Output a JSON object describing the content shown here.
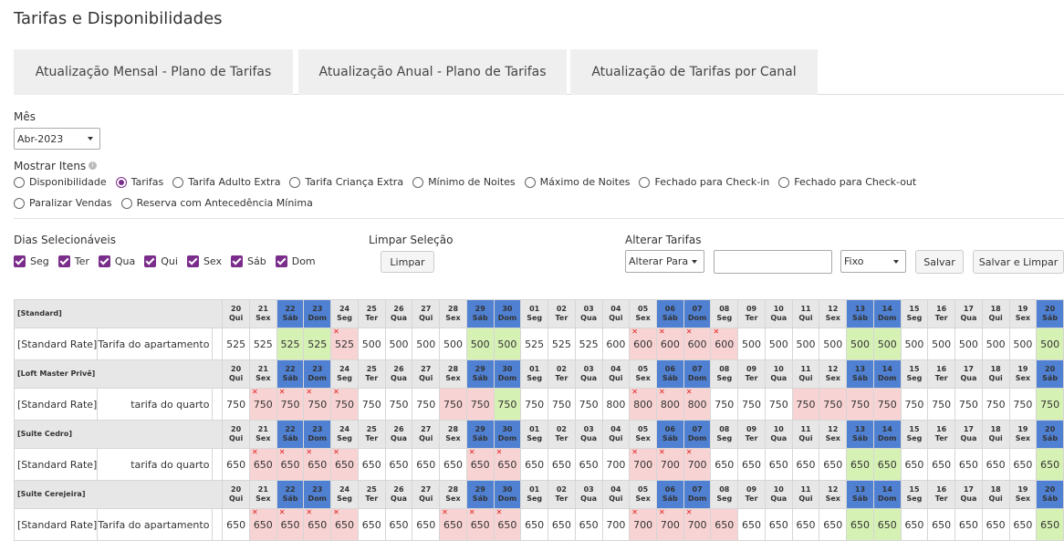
{
  "page_title": "Tarifas e Disponibilidades",
  "tabs": [
    {
      "label": "Atualização Mensal - Plano de Tarifas"
    },
    {
      "label": "Atualização Anual - Plano de Tarifas"
    },
    {
      "label": "Atualização de Tarifas por Canal"
    }
  ],
  "month": {
    "label": "Mês",
    "value": "Abr-2023"
  },
  "show_items": {
    "label": "Mostrar Itens",
    "options": [
      {
        "label": "Disponibilidade",
        "selected": false
      },
      {
        "label": "Tarifas",
        "selected": true
      },
      {
        "label": "Tarifa Adulto Extra",
        "selected": false
      },
      {
        "label": "Tarifa Criança Extra",
        "selected": false
      },
      {
        "label": "Mínimo de Noites",
        "selected": false
      },
      {
        "label": "Máximo de Noites",
        "selected": false
      },
      {
        "label": "Fechado para Check-in",
        "selected": false
      },
      {
        "label": "Fechado para Check-out",
        "selected": false
      },
      {
        "label": "Paralizar Vendas",
        "selected": false
      },
      {
        "label": "Reserva com Antecedência Mínima",
        "selected": false
      }
    ]
  },
  "selectable_days": {
    "label": "Dias Selecionáveis",
    "days": [
      {
        "label": "Seg",
        "checked": true
      },
      {
        "label": "Ter",
        "checked": true
      },
      {
        "label": "Qua",
        "checked": true
      },
      {
        "label": "Qui",
        "checked": true
      },
      {
        "label": "Sex",
        "checked": true
      },
      {
        "label": "Sáb",
        "checked": true
      },
      {
        "label": "Dom",
        "checked": true
      }
    ]
  },
  "clear_selection": {
    "label": "Limpar Seleção",
    "button": "Limpar"
  },
  "change_rates": {
    "label": "Alterar Tarifas",
    "mode": "Alterar Para",
    "value": "",
    "type": "Fixo",
    "save": "Salvar",
    "save_clear": "Salvar e Limpar"
  },
  "colors": {
    "weekend_header": "#4f80d2",
    "green_cell": "#d6f1b4",
    "red_cell": "#f8d3d3",
    "accent": "#7b2d8b"
  },
  "dates": [
    {
      "d": "20",
      "w": "Qui",
      "we": false
    },
    {
      "d": "21",
      "w": "Sex",
      "we": false
    },
    {
      "d": "22",
      "w": "Sáb",
      "we": true
    },
    {
      "d": "23",
      "w": "Dom",
      "we": true
    },
    {
      "d": "24",
      "w": "Seg",
      "we": false
    },
    {
      "d": "25",
      "w": "Ter",
      "we": false
    },
    {
      "d": "26",
      "w": "Qua",
      "we": false
    },
    {
      "d": "27",
      "w": "Qui",
      "we": false
    },
    {
      "d": "28",
      "w": "Sex",
      "we": false
    },
    {
      "d": "29",
      "w": "Sáb",
      "we": true
    },
    {
      "d": "30",
      "w": "Dom",
      "we": true
    },
    {
      "d": "01",
      "w": "Seg",
      "we": false
    },
    {
      "d": "02",
      "w": "Ter",
      "we": false
    },
    {
      "d": "03",
      "w": "Qua",
      "we": false
    },
    {
      "d": "04",
      "w": "Qui",
      "we": false
    },
    {
      "d": "05",
      "w": "Sex",
      "we": false
    },
    {
      "d": "06",
      "w": "Sáb",
      "we": true
    },
    {
      "d": "07",
      "w": "Dom",
      "we": true
    },
    {
      "d": "08",
      "w": "Seg",
      "we": false
    },
    {
      "d": "09",
      "w": "Ter",
      "we": false
    },
    {
      "d": "10",
      "w": "Qua",
      "we": false
    },
    {
      "d": "11",
      "w": "Qui",
      "we": false
    },
    {
      "d": "12",
      "w": "Sex",
      "we": false
    },
    {
      "d": "13",
      "w": "Sáb",
      "we": true
    },
    {
      "d": "14",
      "w": "Dom",
      "we": true
    },
    {
      "d": "15",
      "w": "Seg",
      "we": false
    },
    {
      "d": "16",
      "w": "Ter",
      "we": false
    },
    {
      "d": "17",
      "w": "Qua",
      "we": false
    },
    {
      "d": "18",
      "w": "Qui",
      "we": false
    },
    {
      "d": "19",
      "w": "Sex",
      "we": false
    },
    {
      "d": "20",
      "w": "Sáb",
      "we": true
    }
  ],
  "rooms": [
    {
      "name": "[Standard]",
      "rate_name": "[Standard Rate]",
      "rate_desc": "Tarifa do apartamento",
      "values": [
        525,
        525,
        525,
        525,
        525,
        500,
        500,
        500,
        500,
        500,
        500,
        525,
        525,
        525,
        600,
        600,
        600,
        600,
        600,
        500,
        500,
        500,
        500,
        500,
        500,
        500,
        500,
        500,
        500,
        500,
        500
      ],
      "state": [
        "w",
        "w",
        "g",
        "g",
        "r",
        "w",
        "w",
        "w",
        "w",
        "g",
        "g",
        "w",
        "w",
        "w",
        "w",
        "r",
        "r",
        "r",
        "r",
        "w",
        "w",
        "w",
        "w",
        "g",
        "g",
        "w",
        "w",
        "w",
        "w",
        "w",
        "g"
      ],
      "closed": [
        0,
        0,
        0,
        0,
        1,
        0,
        0,
        0,
        0,
        0,
        0,
        0,
        0,
        0,
        0,
        1,
        1,
        1,
        1,
        0,
        0,
        0,
        0,
        0,
        0,
        0,
        0,
        0,
        0,
        0,
        0
      ]
    },
    {
      "name": "[Loft Master Privê]",
      "rate_name": "[Standard Rate]",
      "rate_desc": "tarifa do quarto",
      "values": [
        750,
        750,
        750,
        750,
        750,
        750,
        750,
        750,
        750,
        750,
        750,
        750,
        750,
        750,
        800,
        800,
        800,
        800,
        750,
        750,
        750,
        750,
        750,
        750,
        750,
        750,
        750,
        750,
        750,
        750,
        750
      ],
      "state": [
        "w",
        "r",
        "r",
        "r",
        "r",
        "w",
        "w",
        "w",
        "r",
        "r",
        "g",
        "w",
        "w",
        "w",
        "w",
        "r",
        "r",
        "r",
        "w",
        "w",
        "w",
        "r",
        "r",
        "r",
        "r",
        "w",
        "w",
        "w",
        "w",
        "w",
        "g"
      ],
      "closed": [
        0,
        1,
        1,
        1,
        1,
        0,
        0,
        0,
        0,
        0,
        0,
        0,
        0,
        0,
        0,
        1,
        1,
        1,
        0,
        0,
        0,
        0,
        0,
        0,
        0,
        0,
        0,
        0,
        0,
        0,
        0
      ]
    },
    {
      "name": "[Suite Cedro]",
      "rate_name": "[Standard Rate]",
      "rate_desc": "tarifa do quarto",
      "values": [
        650,
        650,
        650,
        650,
        650,
        650,
        650,
        650,
        650,
        650,
        650,
        650,
        650,
        650,
        700,
        700,
        700,
        700,
        650,
        650,
        650,
        650,
        650,
        650,
        650,
        650,
        650,
        650,
        650,
        650,
        650
      ],
      "state": [
        "w",
        "r",
        "r",
        "r",
        "r",
        "w",
        "w",
        "w",
        "w",
        "r",
        "r",
        "w",
        "w",
        "w",
        "w",
        "r",
        "r",
        "r",
        "w",
        "w",
        "w",
        "w",
        "w",
        "g",
        "g",
        "w",
        "w",
        "w",
        "w",
        "w",
        "g"
      ],
      "closed": [
        0,
        1,
        1,
        1,
        1,
        0,
        0,
        0,
        0,
        1,
        1,
        0,
        0,
        0,
        0,
        1,
        1,
        1,
        0,
        0,
        0,
        0,
        0,
        0,
        0,
        0,
        0,
        0,
        0,
        0,
        0
      ]
    },
    {
      "name": "[Suite Cerejeira]",
      "rate_name": "[Standard Rate]",
      "rate_desc": "Tarifa do apartamento",
      "values": [
        650,
        650,
        650,
        650,
        650,
        650,
        650,
        650,
        650,
        650,
        650,
        650,
        650,
        650,
        700,
        700,
        700,
        700,
        650,
        650,
        650,
        650,
        650,
        650,
        650,
        650,
        650,
        650,
        650,
        650,
        650
      ],
      "state": [
        "w",
        "r",
        "r",
        "r",
        "r",
        "w",
        "w",
        "w",
        "r",
        "r",
        "r",
        "w",
        "w",
        "w",
        "w",
        "r",
        "r",
        "r",
        "r",
        "w",
        "w",
        "w",
        "w",
        "g",
        "g",
        "w",
        "w",
        "w",
        "w",
        "w",
        "g"
      ],
      "closed": [
        0,
        1,
        1,
        1,
        1,
        0,
        0,
        0,
        1,
        1,
        1,
        0,
        0,
        0,
        0,
        1,
        1,
        1,
        0,
        0,
        0,
        0,
        0,
        0,
        0,
        0,
        0,
        0,
        0,
        0,
        0
      ]
    }
  ]
}
